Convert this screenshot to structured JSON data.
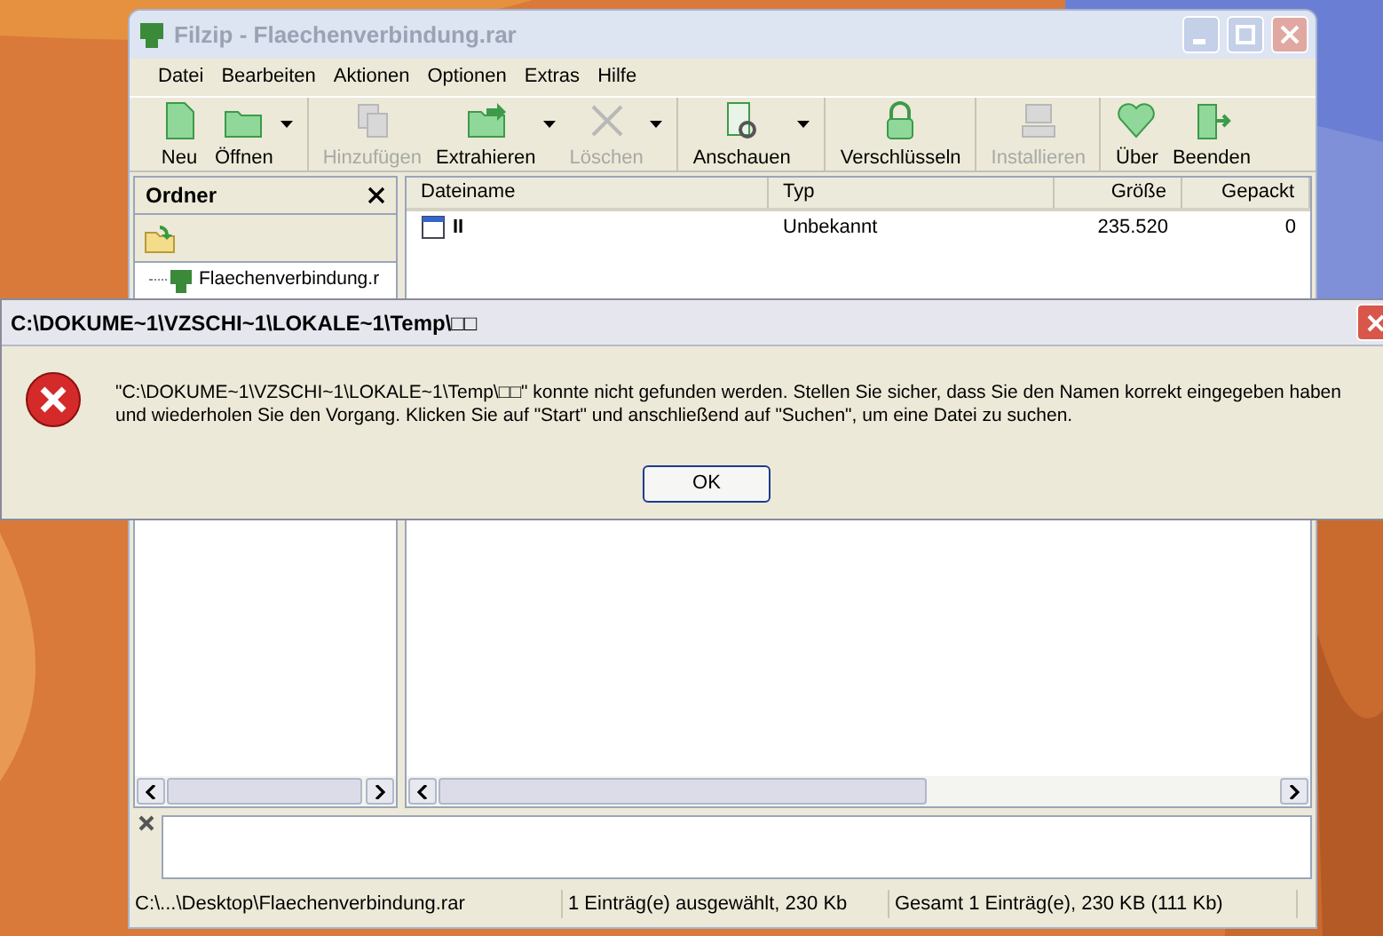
{
  "window": {
    "title": "Filzip - Flaechenverbindung.rar",
    "active": false
  },
  "menu": [
    "Datei",
    "Bearbeiten",
    "Aktionen",
    "Optionen",
    "Extras",
    "Hilfe"
  ],
  "toolbar": [
    [
      {
        "label": "Neu",
        "disabled": false,
        "dropdown": false
      },
      {
        "label": "Öffnen",
        "disabled": false,
        "dropdown": true
      }
    ],
    [
      {
        "label": "Hinzufügen",
        "disabled": true,
        "dropdown": false
      },
      {
        "label": "Extrahieren",
        "disabled": false,
        "dropdown": true
      },
      {
        "label": "Löschen",
        "disabled": true,
        "dropdown": true
      }
    ],
    [
      {
        "label": "Anschauen",
        "disabled": false,
        "dropdown": true
      }
    ],
    [
      {
        "label": "Verschlüsseln",
        "disabled": false,
        "dropdown": false
      }
    ],
    [
      {
        "label": "Installieren",
        "disabled": true,
        "dropdown": false
      }
    ],
    [
      {
        "label": "Über",
        "disabled": false,
        "dropdown": false
      },
      {
        "label": "Beenden",
        "disabled": false,
        "dropdown": false
      }
    ]
  ],
  "folders": {
    "title": "Ordner",
    "items": [
      {
        "label": "Flaechenverbindung.r"
      }
    ]
  },
  "table": {
    "columns": [
      "Dateiname",
      "Typ",
      "Größe",
      "Gepackt"
    ],
    "rows": [
      [
        "II",
        "Unbekannt",
        "235.520",
        "0"
      ]
    ]
  },
  "status_bar": [
    "C:\\...\\Desktop\\Flaechenverbindung.rar",
    "1 Einträg(e) ausgewählt, 230 Kb",
    "Gesamt 1 Einträg(e), 230 KB (111 Kb)"
  ],
  "dialog": {
    "title": "C:\\DOKUME~1\\VZSCHI~1\\LOKALE~1\\Temp\\□□",
    "message": "\"C:\\DOKUME~1\\VZSCHI~1\\LOKALE~1\\Temp\\□□\" konnte nicht gefunden werden. Stellen Sie sicher, dass Sie den Namen korrekt eingegeben haben und wiederholen Sie den Vorgang. Klicken Sie auf \"Start\" und anschließend auf \"Suchen\", um eine Datei zu suchen.",
    "button": "OK"
  }
}
